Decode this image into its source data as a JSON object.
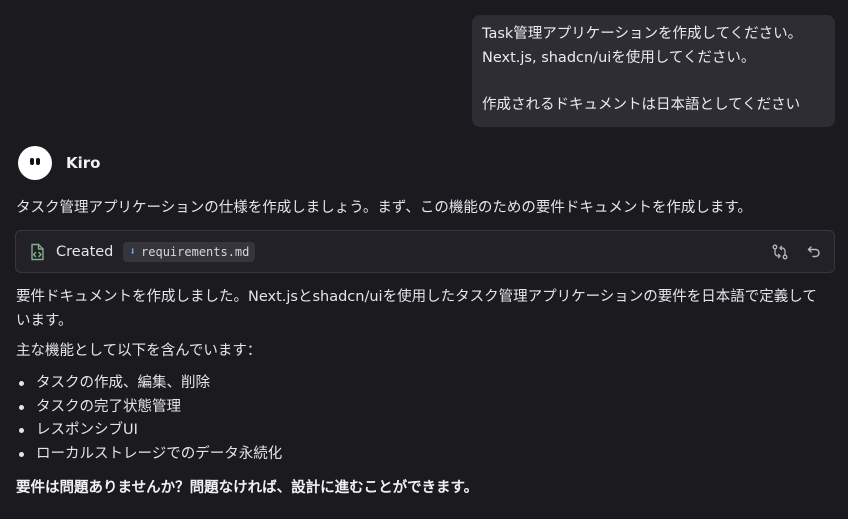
{
  "user_message": {
    "line1": "Task管理アプリケーションを作成してください。",
    "line2": "Next.js, shadcn/uiを使用してください。",
    "line3": "作成されるドキュメントは日本語としてください"
  },
  "agent": {
    "name": "Kiro",
    "intro": "タスク管理アプリケーションの仕様を作成しましょう。まず、この機能のための要件ドキュメントを作成します。",
    "file_action": {
      "status": "Created",
      "filename": "requirements.md",
      "icon": "file-code-icon"
    },
    "done_text": "要件ドキュメントを作成しました。Next.jsとshadcn/uiを使用したタスク管理アプリケーションの要件を日本語で定義しています。",
    "features_intro": "主な機能として以下を含んでいます：",
    "features": [
      "タスクの作成、編集、削除",
      "タスクの完了状態管理",
      "レスポンシブUI",
      "ローカルストレージでのデータ永続化"
    ],
    "question": "要件は問題ありませんか？問題なければ、設計に進むことができます。"
  },
  "colors": {
    "background": "#1b1a1f",
    "bubble": "#2e2d33",
    "accent_green": "#7fb08a",
    "md_blue": "#6d9be8"
  }
}
